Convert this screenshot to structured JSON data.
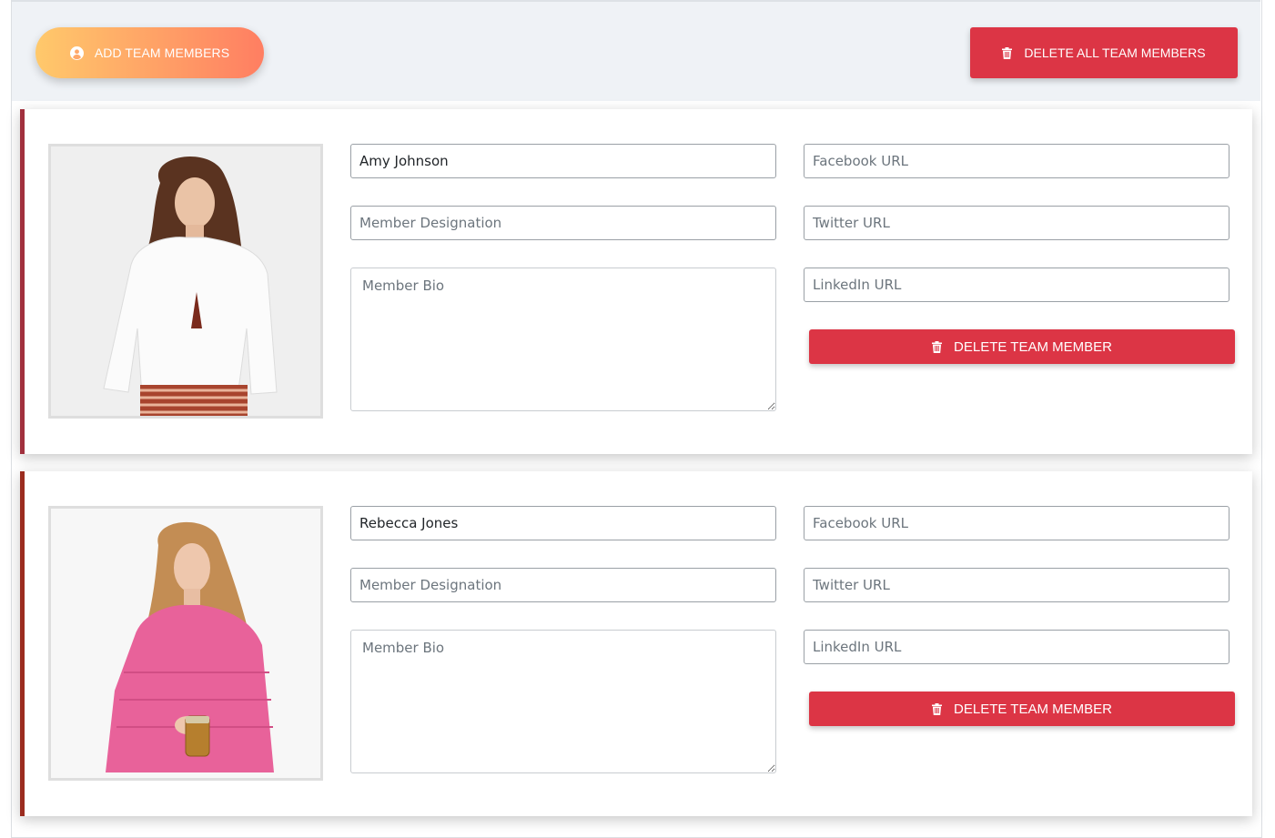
{
  "toolbar": {
    "add_label": "ADD TEAM MEMBERS",
    "delete_all_label": "DELETE ALL TEAM MEMBERS"
  },
  "members": [
    {
      "name": "Amy Johnson",
      "designation_placeholder": "Member Designation",
      "bio_placeholder": "Member Bio",
      "facebook_placeholder": "Facebook URL",
      "twitter_placeholder": "Twitter URL",
      "linkedin_placeholder": "LinkedIn URL",
      "delete_label": "DELETE TEAM MEMBER",
      "accent": "#a1303d"
    },
    {
      "name": "Rebecca Jones",
      "designation_placeholder": "Member Designation",
      "bio_placeholder": "Member Bio",
      "facebook_placeholder": "Facebook URL",
      "twitter_placeholder": "Twitter URL",
      "linkedin_placeholder": "LinkedIn URL",
      "delete_label": "DELETE TEAM MEMBER",
      "accent": "#9b2c1f"
    }
  ],
  "colors": {
    "danger": "#dc3545",
    "add_gradient_start": "#ffc96b",
    "add_gradient_end": "#ff7e62",
    "toolbar_bg": "#eff2f6"
  }
}
